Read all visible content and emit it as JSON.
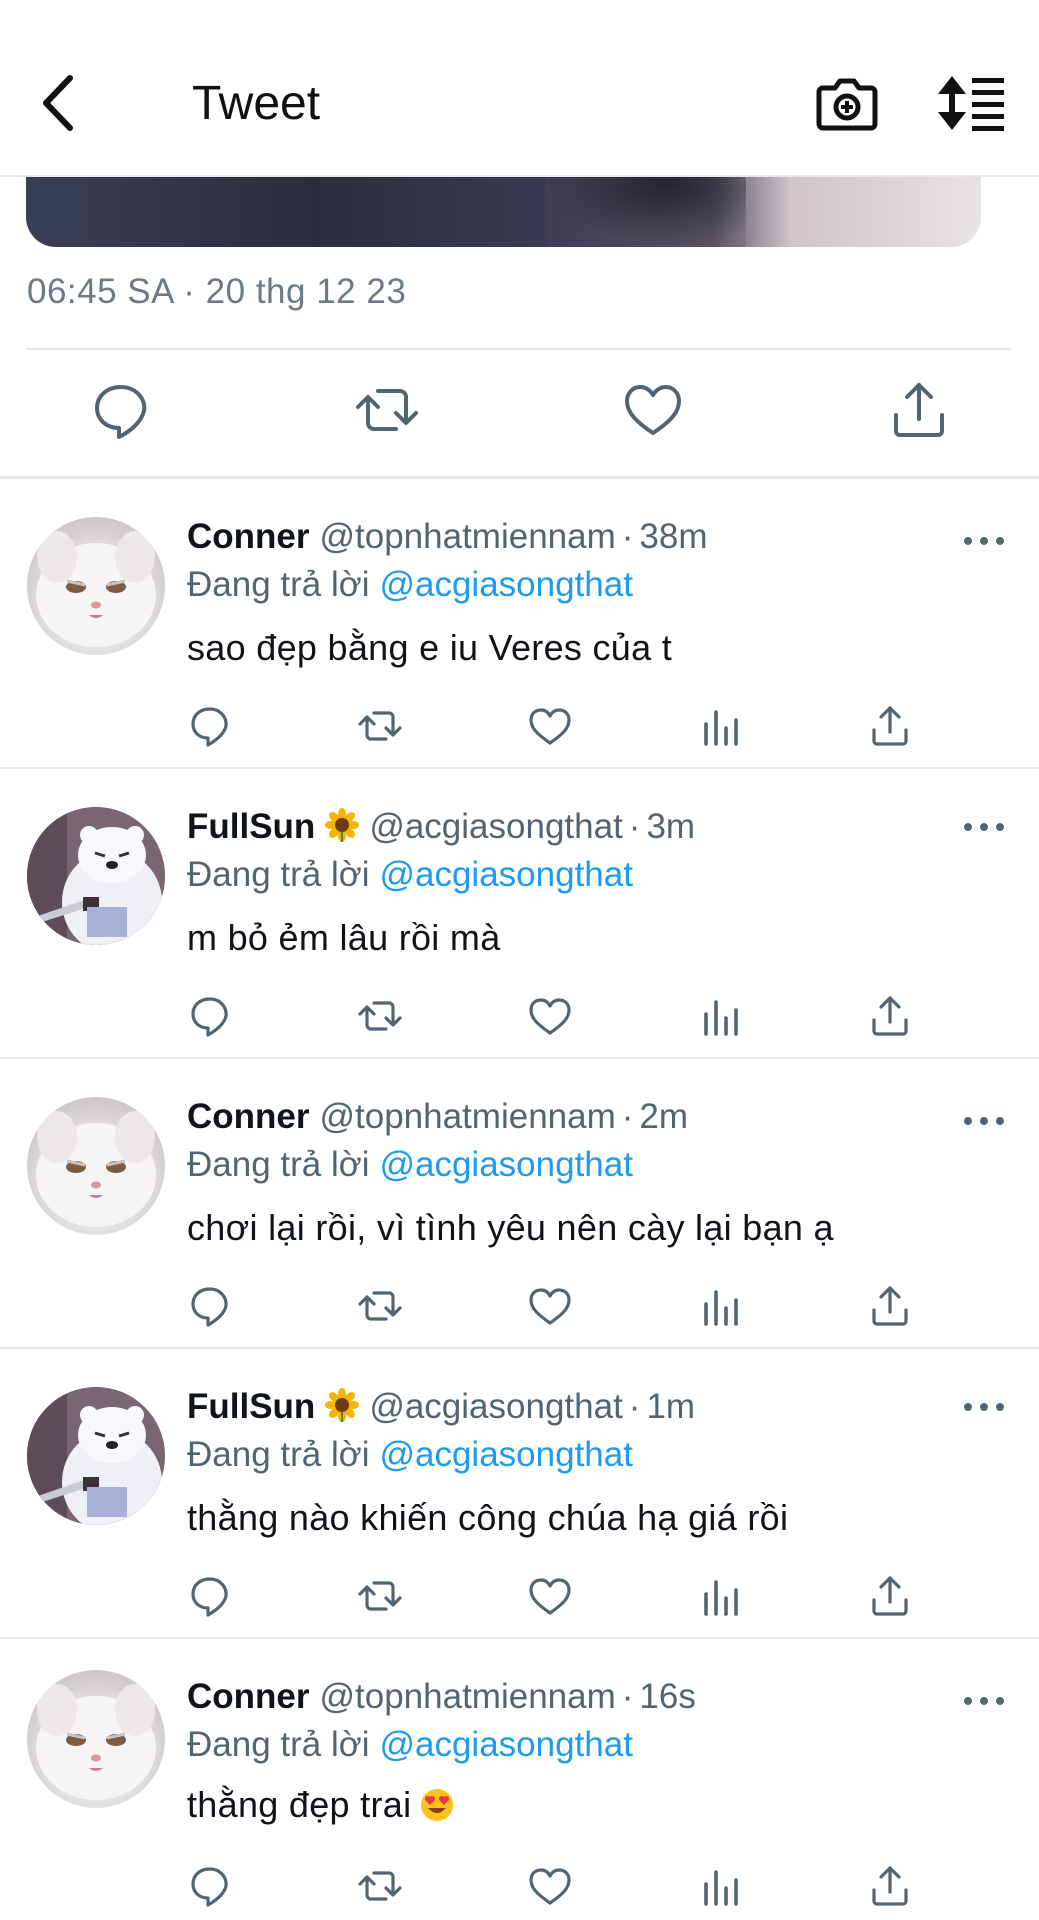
{
  "header": {
    "title": "Tweet",
    "back_icon": "chevron-left-icon",
    "camera_icon": "camera-add-icon",
    "sort_icon": "sort-list-icon"
  },
  "tweet": {
    "timestamp": "06:45 SA · 20 thg 12 23",
    "actions": [
      "reply-icon",
      "retweet-icon",
      "like-icon",
      "share-icon"
    ]
  },
  "replies": [
    {
      "name": "Conner",
      "name_emoji": "",
      "handle": "@topnhatmiennam",
      "ago": "38m",
      "replying_label": "Đang trả lời",
      "replying_to": "@acgiasongthat",
      "text": "sao đẹp bằng e iu Veres của t",
      "text_emoji": "",
      "avatar": "white-cat-avatar"
    },
    {
      "name": "FullSun",
      "name_emoji": "sunflower",
      "handle": "@acgiasongthat",
      "ago": "3m",
      "replying_label": "Đang trả lời",
      "replying_to": "@acgiasongthat",
      "text": "m bỏ ẻm lâu rồi mà",
      "text_emoji": "",
      "avatar": "ice-bear-avatar"
    },
    {
      "name": "Conner",
      "name_emoji": "",
      "handle": "@topnhatmiennam",
      "ago": "2m",
      "replying_label": "Đang trả lời",
      "replying_to": "@acgiasongthat",
      "text": "chơi lại rồi, vì tình yêu nên cày lại bạn ạ",
      "text_emoji": "",
      "avatar": "white-cat-avatar"
    },
    {
      "name": "FullSun",
      "name_emoji": "sunflower",
      "handle": "@acgiasongthat",
      "ago": "1m",
      "replying_label": "Đang trả lời",
      "replying_to": "@acgiasongthat",
      "text": "thằng nào khiến công chúa hạ giá rồi",
      "text_emoji": "",
      "avatar": "ice-bear-avatar"
    },
    {
      "name": "Conner",
      "name_emoji": "",
      "handle": "@topnhatmiennam",
      "ago": "16s",
      "replying_label": "Đang trả lời",
      "replying_to": "@acgiasongthat",
      "text": "thằng đẹp trai",
      "text_emoji": "heart-eyes",
      "avatar": "white-cat-avatar"
    }
  ],
  "reply_actions": [
    "reply-icon",
    "retweet-icon",
    "like-icon",
    "views-icon",
    "share-icon"
  ],
  "colors": {
    "link": "#1d9bf0",
    "secondary_text": "#536471",
    "divider": "#e6e8ea"
  }
}
